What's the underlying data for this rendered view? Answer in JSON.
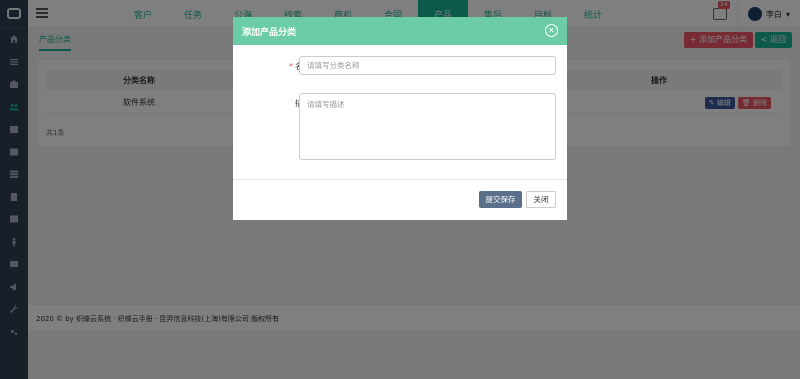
{
  "colors": {
    "primary": "#1ab394",
    "danger": "#ed5565",
    "sidebar": "#2f4050",
    "modal_header": "#6ccca5",
    "save_button": "#5a708a"
  },
  "sidebar": {
    "icons": [
      "home-icon",
      "list-icon",
      "briefcase-icon",
      "users-icon",
      "calendar-icon",
      "table-icon",
      "stack-icon",
      "book-icon",
      "columns-icon",
      "person-icon",
      "image-icon",
      "megaphone-icon",
      "wrench-icon",
      "gears-icon"
    ],
    "active_index": 3
  },
  "nav": {
    "items": [
      {
        "label": "客户"
      },
      {
        "label": "任务"
      },
      {
        "label": "公海"
      },
      {
        "label": "线索"
      },
      {
        "label": "商机"
      },
      {
        "label": "合同"
      },
      {
        "label": "产品"
      },
      {
        "label": "售后"
      },
      {
        "label": "目标"
      },
      {
        "label": "统计"
      }
    ],
    "active_index": 6
  },
  "topbar": {
    "mail_badge": "54",
    "user_name": "李白"
  },
  "subbar": {
    "tab": "产品分类",
    "add_button": "+ 添加产品分类",
    "back_button": "< 返回"
  },
  "table": {
    "headers": {
      "name": "分类名称",
      "ops": "操作"
    },
    "rows": [
      {
        "name": "软件系统",
        "edit": "编辑",
        "delete": "删除"
      }
    ],
    "total": "共1条"
  },
  "footer": {
    "text": "2020 © by 织蝶云系统 · 织蝶云手册 · 昆羿信息科技(上海)有限公司 版权所有"
  },
  "modal": {
    "title": "添加产品分类",
    "fields": {
      "name": {
        "label": "名称",
        "required": "*",
        "placeholder": "请填写分类名称"
      },
      "desc": {
        "label": "描述",
        "placeholder": "请填写描述"
      }
    },
    "save_button": "提交保存",
    "close_button": "关闭"
  }
}
